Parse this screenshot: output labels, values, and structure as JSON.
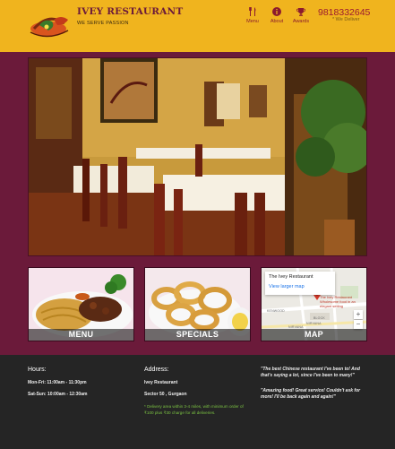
{
  "header": {
    "brand_title": "IVEY RESTAURANT",
    "tagline": "WE SERVE PASSION",
    "nav": [
      {
        "label": "Menu",
        "icon": "fork-knife-icon"
      },
      {
        "label": "About",
        "icon": "info-icon"
      },
      {
        "label": "Awards",
        "icon": "trophy-icon"
      }
    ],
    "phone": "9818332645",
    "deliver": "* We Deliver"
  },
  "tiles": {
    "menu": "MENU",
    "specials": "SPECIALS",
    "map": "MAP"
  },
  "map": {
    "card_title": "The Ivey Restaurant",
    "view_larger": "View larger map",
    "pin_label": "The Ivey Restaurant Wholesome food in an elegant setting",
    "zoom_in": "+",
    "zoom_out": "−",
    "labels": [
      "KENWOOD",
      "BLOCK",
      "NIRVANA",
      "NIRVANA"
    ]
  },
  "footer": {
    "hours_heading": "Hours:",
    "hours": [
      "Mon-Fri: 11:00am - 11:30pm",
      "Sat-Sun: 10:00am - 12:30am"
    ],
    "address_heading": "Address:",
    "address": [
      "Ivey Restaurant",
      "Sector 50 , Gurgaon"
    ],
    "delivery_note": "* Delivery area within 3-4 miles, with minimum order of ₹100 plus ₹30 charge for all deliveries.",
    "quotes": [
      "\"The best Chinese restaurant I've been to! And that's saying a lot, since I've been to many!\"",
      "\"Amazing food! Great service! Couldn't ask for more! I'll be back again and again!\""
    ]
  },
  "colors": {
    "header_bg": "#f0b41e",
    "page_bg": "#6b1a3a",
    "footer_bg": "#252525",
    "accent_red": "#9b1a30",
    "note_green": "#7ac142"
  }
}
